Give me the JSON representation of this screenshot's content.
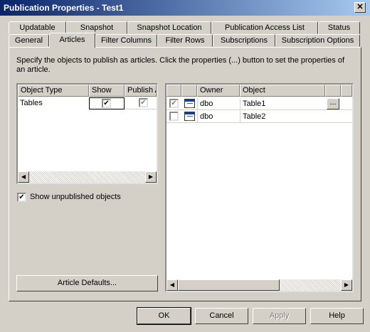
{
  "window": {
    "title": "Publication Properties - Test1",
    "close_glyph": "✕"
  },
  "tabs_back": [
    "Updatable",
    "Snapshot",
    "Snapshot Location",
    "Publication Access List",
    "Status"
  ],
  "tabs_front": [
    "General",
    "Articles",
    "Filter Columns",
    "Filter Rows",
    "Subscriptions",
    "Subscription Options"
  ],
  "active_tab": "Articles",
  "description": "Specify the objects to publish as articles. Click the properties (...) button to set the properties of an article.",
  "object_types": {
    "headers": [
      "Object Type",
      "Show",
      "Publish A"
    ],
    "rows": [
      {
        "type": "Tables",
        "show": true,
        "publish_all": true
      }
    ]
  },
  "show_unpublished": {
    "label": "Show unpublished objects",
    "checked": true
  },
  "article_defaults_label": "Article Defaults...",
  "articles": {
    "headers": [
      "",
      "",
      "Owner",
      "Object",
      ""
    ],
    "rows": [
      {
        "published": true,
        "icon": "table-icon",
        "owner": "dbo",
        "object": "Table1",
        "props": "..."
      },
      {
        "published": false,
        "icon": "table-icon",
        "owner": "dbo",
        "object": "Table2",
        "props": ""
      }
    ]
  },
  "buttons": {
    "ok": "OK",
    "cancel": "Cancel",
    "apply": "Apply",
    "help": "Help"
  },
  "glyphs": {
    "check": "✔",
    "left": "◀",
    "right": "▶"
  },
  "colors": {
    "titlebar_start": "#0a246a",
    "titlebar_end": "#a6caf0",
    "face": "#d4d0c8"
  }
}
